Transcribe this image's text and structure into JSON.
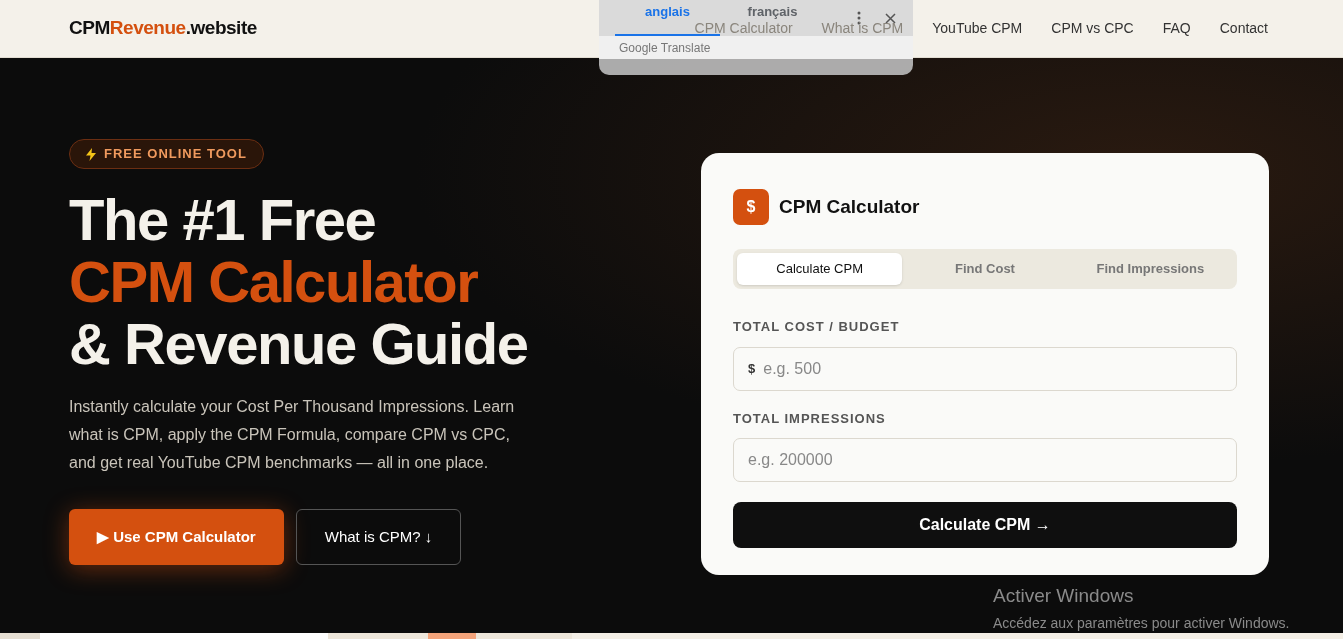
{
  "header": {
    "logo": {
      "part1": "CPM",
      "part2": "Revenue",
      "part3": ".website"
    },
    "nav": [
      {
        "label": "CPM Calculator",
        "obscured": true
      },
      {
        "label": "What is CPM",
        "obscured": true
      },
      {
        "label": "YouTube CPM",
        "obscured": false
      },
      {
        "label": "CPM vs CPC",
        "obscured": false
      },
      {
        "label": "FAQ",
        "obscured": false
      },
      {
        "label": "Contact",
        "obscured": false
      }
    ]
  },
  "translate_popup": {
    "languages": [
      {
        "label": "anglais",
        "selected": true
      },
      {
        "label": "français",
        "selected": false
      }
    ],
    "footer": "Google Translate"
  },
  "hero": {
    "badge": "FREE ONLINE TOOL",
    "title_lines": [
      "The #1 Free",
      "CPM Calculator",
      "& Revenue Guide"
    ],
    "description": "Instantly calculate your Cost Per Thousand Impressions. Learn what is CPM, apply the CPM Formula, compare CPM vs CPC, and get real YouTube CPM benchmarks — all in one place.",
    "buttons": [
      {
        "label": "▶ Use CPM Calculator",
        "kind": "primary"
      },
      {
        "label": "What is CPM? ↓",
        "kind": "outline"
      }
    ]
  },
  "calculator": {
    "title": "CPM Calculator",
    "icon_text": "$",
    "tabs": [
      {
        "label": "Calculate CPM",
        "selected": true
      },
      {
        "label": "Find Cost",
        "selected": false
      },
      {
        "label": "Find Impressions",
        "selected": false
      }
    ],
    "fields": [
      {
        "label": "TOTAL COST / BUDGET",
        "prefix": "$",
        "placeholder": "e.g. 500"
      },
      {
        "label": "TOTAL IMPRESSIONS",
        "placeholder": "e.g. 200000"
      }
    ],
    "submit": "Calculate CPM →"
  },
  "os_notice": {
    "title": "Activer Windows",
    "text": "Accédez aux paramètres pour activer Windows."
  }
}
